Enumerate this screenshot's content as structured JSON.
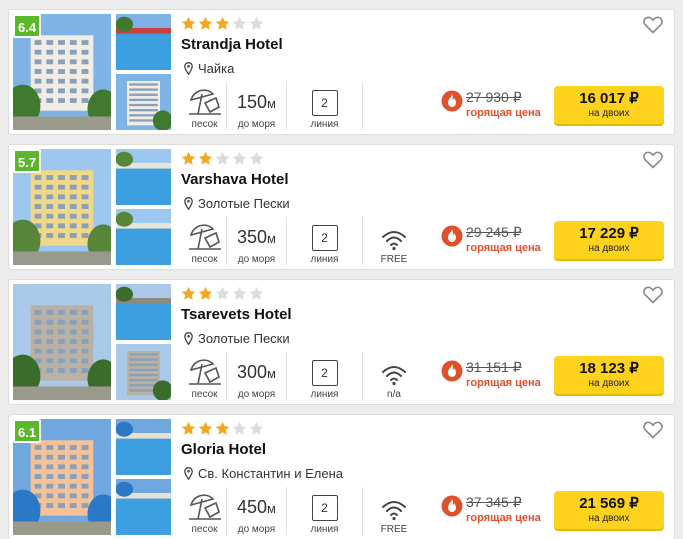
{
  "labels": {
    "beach": "песок",
    "to_sea": "до моря",
    "line": "линия",
    "hot": "горящая цена",
    "per": "на двоих",
    "unit": "м"
  },
  "colors": {
    "rating": "#5cb82b",
    "star_on": "#f5a623",
    "star_off": "#dcdcdc",
    "button": "#ffd31d",
    "hot": "#e0502b"
  },
  "hotels": [
    {
      "rating": "6.4",
      "stars": 3,
      "name": "Strandja Hotel",
      "location": "Чайка",
      "distance": "150",
      "line": "2",
      "wifi": null,
      "old_price": "27 930 ₽",
      "price": "16 017 ₽"
    },
    {
      "rating": "5.7",
      "stars": 2,
      "name": "Varshava Hotel",
      "location": "Золотые Пески",
      "distance": "350",
      "line": "2",
      "wifi": "FREE",
      "old_price": "29 245 ₽",
      "price": "17 229 ₽"
    },
    {
      "rating": "",
      "stars": 2,
      "name": "Tsarevets Hotel",
      "location": "Золотые Пески",
      "distance": "300",
      "line": "2",
      "wifi": "n/a",
      "old_price": "31 151 ₽",
      "price": "18 123 ₽"
    },
    {
      "rating": "6.1",
      "stars": 3,
      "name": "Gloria Hotel",
      "location": "Св. Константин и Елена",
      "distance": "450",
      "line": "2",
      "wifi": "FREE",
      "old_price": "37 345 ₽",
      "price": "21 569 ₽"
    }
  ]
}
